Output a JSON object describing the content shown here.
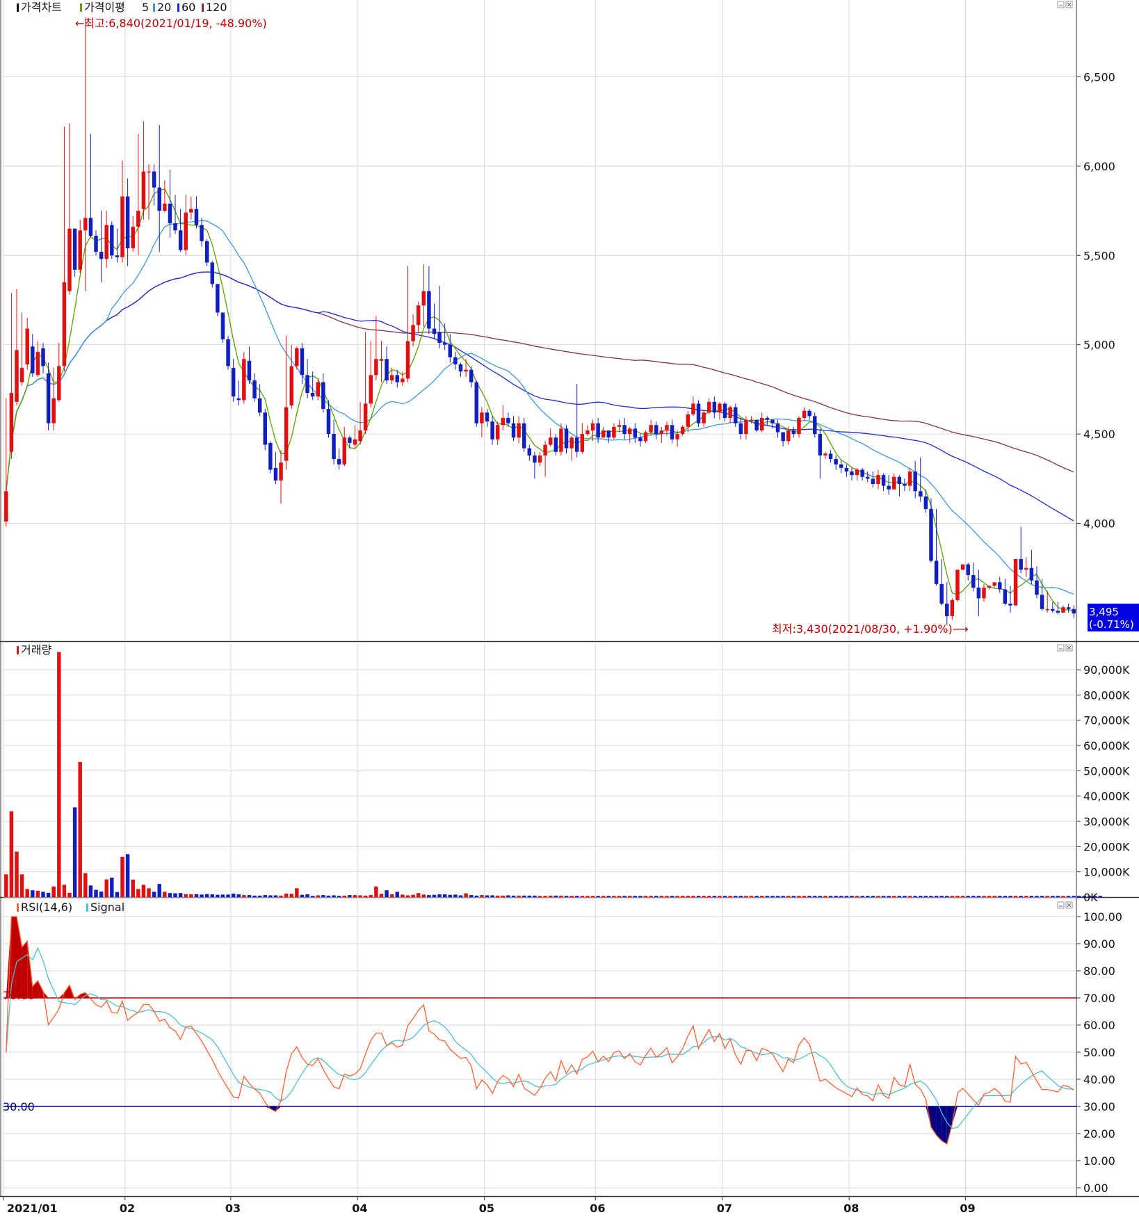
{
  "colors": {
    "up": "#e01010",
    "down": "#1020c0",
    "ma5": "#5aa000",
    "ma20": "#3a9ad9",
    "ma60": "#1c2ad0",
    "ma120": "#80304a",
    "rsi": "#ff6030",
    "signal": "#4ac0d0",
    "ob_line": "#c00000",
    "os_line": "#000080",
    "grid": "#d8d8d8",
    "label_bg": "#0000e0"
  },
  "chart_data": [
    {
      "type": "candlestick",
      "title": "가격차트",
      "legend": [
        {
          "label": "가격이평",
          "color": "#5aa000"
        },
        {
          "label": "5",
          "color": "#5aa000"
        },
        {
          "label": "20",
          "color": "#3a9ad9"
        },
        {
          "label": "60",
          "color": "#1c2ad0"
        },
        {
          "label": "120",
          "color": "#80304a"
        }
      ],
      "ylim": [
        3340,
        6930
      ],
      "yticks": [
        4000,
        4500,
        5000,
        5500,
        6000,
        6500
      ],
      "ytick_labels": [
        "4,000",
        "4,500",
        "5,000",
        "5,500",
        "6,000",
        "6,500"
      ],
      "months": [
        "2021/01",
        "02",
        "03",
        "04",
        "05",
        "06",
        "07",
        "08",
        "09"
      ],
      "month_start_index": [
        0,
        23,
        43,
        67,
        91,
        112,
        136,
        160,
        182
      ],
      "high_note": "←최고:6,840(2021/01/19, -48.90%)",
      "low_note": "최저:3,430(2021/08/30, +1.90%)⟶",
      "last_price": "3,495",
      "last_change": "(-0.71%)",
      "candles": {
        "close": [
          4180,
          4730,
          4970,
          4870,
          5090,
          4840,
          4960,
          4880,
          4560,
          4700,
          4880,
          5350,
          5650,
          5420,
          5640,
          5710,
          5610,
          5520,
          5480,
          5670,
          5500,
          5490,
          5830,
          5540,
          5660,
          5750,
          5970,
          5970,
          5880,
          5750,
          5790,
          5680,
          5640,
          5530,
          5740,
          5760,
          5670,
          5580,
          5460,
          5340,
          5180,
          5030,
          4880,
          4710,
          4690,
          4920,
          4800,
          4700,
          4620,
          4440,
          4300,
          4240,
          4340,
          4650,
          4880,
          4980,
          4830,
          4730,
          4710,
          4790,
          4640,
          4500,
          4360,
          4330,
          4480,
          4450,
          4470,
          4520,
          4670,
          4830,
          4920,
          4920,
          4800,
          4830,
          4790,
          4810,
          5020,
          5110,
          5220,
          5300,
          5090,
          5060,
          5010,
          5000,
          4930,
          4890,
          4850,
          4860,
          4790,
          4560,
          4620,
          4570,
          4470,
          4550,
          4590,
          4560,
          4480,
          4560,
          4420,
          4380,
          4340,
          4380,
          4440,
          4480,
          4400,
          4530,
          4420,
          4480,
          4400,
          4500,
          4520,
          4560,
          4480,
          4520,
          4480,
          4540,
          4550,
          4500,
          4530,
          4480,
          4460,
          4510,
          4550,
          4500,
          4520,
          4550,
          4470,
          4500,
          4540,
          4610,
          4670,
          4560,
          4620,
          4680,
          4620,
          4670,
          4590,
          4650,
          4560,
          4500,
          4580,
          4580,
          4520,
          4590,
          4580,
          4560,
          4510,
          4460,
          4520,
          4500,
          4590,
          4630,
          4600,
          4500,
          4380,
          4390,
          4360,
          4330,
          4310,
          4290,
          4270,
          4300,
          4260,
          4250,
          4220,
          4270,
          4210,
          4190,
          4260,
          4220,
          4210,
          4290,
          4180,
          4150,
          4080,
          3790,
          3660,
          3550,
          3480,
          3570,
          3740,
          3770,
          3710,
          3640,
          3580,
          3640,
          3650,
          3670,
          3630,
          3550,
          3540,
          3800,
          3740,
          3750,
          3680,
          3600,
          3520,
          3520,
          3510,
          3500,
          3530,
          3520,
          3495
        ],
        "open": [
          4010,
          4400,
          4680,
          4790,
          4890,
          4990,
          4830,
          4980,
          4840,
          4560,
          4690,
          4880,
          5300,
          5650,
          5420,
          5640,
          5710,
          5610,
          5520,
          5480,
          5670,
          5500,
          5490,
          5830,
          5540,
          5660,
          5760,
          5970,
          5970,
          5880,
          5750,
          5790,
          5680,
          5640,
          5530,
          5740,
          5760,
          5670,
          5580,
          5460,
          5340,
          5180,
          5030,
          4870,
          4700,
          4690,
          4910,
          4800,
          4700,
          4620,
          4450,
          4310,
          4240,
          4350,
          4660,
          4880,
          4980,
          4830,
          4730,
          4710,
          4790,
          4640,
          4500,
          4360,
          4330,
          4480,
          4440,
          4460,
          4520,
          4670,
          4830,
          4910,
          4920,
          4800,
          4830,
          4790,
          4810,
          5020,
          5110,
          5220,
          5300,
          5090,
          5070,
          5010,
          5000,
          4930,
          4890,
          4850,
          4860,
          4790,
          4560,
          4620,
          4570,
          4470,
          4550,
          4590,
          4560,
          4480,
          4560,
          4420,
          4380,
          4340,
          4380,
          4440,
          4480,
          4400,
          4530,
          4420,
          4480,
          4400,
          4500,
          4520,
          4560,
          4480,
          4520,
          4480,
          4540,
          4550,
          4500,
          4530,
          4480,
          4460,
          4510,
          4550,
          4500,
          4520,
          4550,
          4470,
          4500,
          4540,
          4610,
          4670,
          4560,
          4620,
          4680,
          4620,
          4670,
          4590,
          4650,
          4560,
          4500,
          4580,
          4580,
          4520,
          4590,
          4580,
          4560,
          4510,
          4460,
          4520,
          4500,
          4590,
          4630,
          4600,
          4500,
          4380,
          4390,
          4360,
          4330,
          4310,
          4290,
          4270,
          4300,
          4260,
          4250,
          4220,
          4270,
          4210,
          4190,
          4260,
          4220,
          4210,
          4290,
          4180,
          4150,
          4080,
          3790,
          3660,
          3550,
          3480,
          3570,
          3740,
          3770,
          3710,
          3640,
          3580,
          3640,
          3650,
          3670,
          3630,
          3550,
          3540,
          3800,
          3740,
          3750,
          3680,
          3600,
          3520,
          3520,
          3510,
          3500,
          3530,
          3520
        ],
        "high": [
          4700,
          5290,
          5310,
          5180,
          5150,
          5060,
          5020,
          5010,
          4900,
          4870,
          5010,
          6220,
          6240,
          5650,
          5700,
          6830,
          6180,
          5640,
          5750,
          5750,
          5690,
          5650,
          6030,
          5930,
          5720,
          6180,
          6250,
          6010,
          6010,
          6230,
          5920,
          5980,
          5840,
          5760,
          5840,
          5830,
          5830,
          5710,
          5590,
          5470,
          5310,
          5180,
          5050,
          4920,
          4800,
          4960,
          4990,
          4840,
          4780,
          4640,
          4460,
          4400,
          4410,
          5050,
          5000,
          4990,
          5010,
          4920,
          4850,
          4810,
          4840,
          4690,
          4580,
          4420,
          4540,
          4490,
          4550,
          4680,
          5070,
          5020,
          5160,
          5020,
          4990,
          4870,
          4860,
          4850,
          5440,
          5170,
          5240,
          5450,
          5440,
          5230,
          5330,
          5120,
          5060,
          4960,
          4900,
          4920,
          4880,
          4800,
          4650,
          4640,
          4600,
          4570,
          4660,
          4620,
          4600,
          4600,
          4590,
          4440,
          4400,
          4400,
          4460,
          4530,
          4500,
          4560,
          4550,
          4490,
          4780,
          4560,
          4550,
          4580,
          4590,
          4540,
          4520,
          4560,
          4580,
          4590,
          4540,
          4560,
          4500,
          4520,
          4580,
          4570,
          4540,
          4570,
          4580,
          4520,
          4550,
          4630,
          4710,
          4690,
          4630,
          4700,
          4710,
          4680,
          4680,
          4660,
          4670,
          4590,
          4600,
          4600,
          4570,
          4620,
          4600,
          4580,
          4580,
          4510,
          4540,
          4540,
          4600,
          4650,
          4640,
          4620,
          4530,
          4400,
          4410,
          4380,
          4350,
          4330,
          4310,
          4310,
          4310,
          4290,
          4290,
          4300,
          4280,
          4270,
          4280,
          4270,
          4250,
          4310,
          4350,
          4370,
          4190,
          4140,
          4080,
          3800,
          3670,
          3580,
          3590,
          3770,
          3780,
          3780,
          3740,
          3660,
          3650,
          3660,
          3700,
          3690,
          3650,
          3580,
          3980,
          3810,
          3850,
          3760,
          3690,
          3620,
          3560,
          3560,
          3540,
          3550,
          3540
        ],
        "low": [
          3980,
          4360,
          4660,
          4770,
          4860,
          4820,
          4820,
          4840,
          4520,
          4520,
          4680,
          4850,
          5280,
          5380,
          5400,
          5300,
          5600,
          5500,
          5350,
          5430,
          5480,
          5460,
          5460,
          5440,
          5520,
          5500,
          5700,
          5700,
          5780,
          5520,
          5740,
          5600,
          5620,
          5520,
          5500,
          5700,
          5650,
          5550,
          5440,
          5320,
          5160,
          5010,
          4860,
          4680,
          4660,
          4670,
          4780,
          4680,
          4600,
          4410,
          4280,
          4220,
          4110,
          4300,
          4640,
          4860,
          4780,
          4700,
          4690,
          4690,
          4620,
          4480,
          4330,
          4300,
          4320,
          4420,
          4420,
          4440,
          4500,
          4650,
          4800,
          4790,
          4780,
          4780,
          4760,
          4770,
          4790,
          4990,
          5070,
          5100,
          5060,
          5030,
          4980,
          4970,
          4900,
          4860,
          4820,
          4820,
          4760,
          4540,
          4480,
          4540,
          4440,
          4440,
          4520,
          4540,
          4460,
          4450,
          4400,
          4350,
          4250,
          4320,
          4260,
          4430,
          4380,
          4380,
          4390,
          4350,
          4370,
          4390,
          4490,
          4460,
          4450,
          4480,
          4450,
          4470,
          4510,
          4470,
          4450,
          4450,
          4430,
          4450,
          4490,
          4470,
          4450,
          4490,
          4450,
          4430,
          4490,
          4510,
          4600,
          4540,
          4540,
          4610,
          4590,
          4580,
          4570,
          4560,
          4540,
          4470,
          4470,
          4560,
          4510,
          4510,
          4550,
          4530,
          4480,
          4430,
          4440,
          4480,
          4480,
          4580,
          4580,
          4480,
          4250,
          4360,
          4340,
          4300,
          4280,
          4260,
          4240,
          4240,
          4240,
          4230,
          4200,
          4190,
          4180,
          4160,
          4190,
          4150,
          4180,
          4180,
          4140,
          4120,
          4060,
          3780,
          3650,
          3540,
          3430,
          3460,
          3560,
          3740,
          3680,
          3620,
          3480,
          3560,
          3630,
          3640,
          3610,
          3540,
          3500,
          3560,
          3720,
          3700,
          3660,
          3580,
          3510,
          3500,
          3500,
          3490,
          3500,
          3500,
          3470
        ]
      }
    },
    {
      "type": "bar",
      "title": "거래량",
      "ylim": [
        0,
        98000
      ],
      "yticks": [
        0,
        10000,
        20000,
        30000,
        40000,
        50000,
        60000,
        70000,
        80000,
        90000
      ],
      "ytick_labels": [
        "0K",
        "10,000K",
        "20,000K",
        "30,000K",
        "40,000K",
        "50,000K",
        "60,000K",
        "70,000K",
        "80,000K",
        "90,000K"
      ],
      "values": [
        9000,
        34000,
        18000,
        9000,
        3200,
        2700,
        2500,
        2100,
        1700,
        4200,
        97000,
        4900,
        1700,
        35500,
        53500,
        9500,
        4600,
        2900,
        2200,
        7000,
        7700,
        2000,
        16000,
        17000,
        6900,
        3200,
        4900,
        3500,
        2100,
        5200,
        2100,
        1600,
        1500,
        1600,
        1200,
        1100,
        1200,
        1000,
        1200,
        1100,
        900,
        1000,
        1000,
        1400,
        1100,
        800,
        800,
        600,
        600,
        800,
        700,
        700,
        600,
        1400,
        1300,
        3500,
        900,
        1100,
        500,
        700,
        800,
        600,
        700,
        500,
        600,
        800,
        800,
        700,
        600,
        800,
        4200,
        1300,
        2700,
        1100,
        2100,
        1000,
        700,
        900,
        1600,
        1000,
        800,
        900,
        1100,
        1100,
        900,
        1000,
        700,
        1500,
        800,
        600,
        800,
        700,
        700,
        600,
        600,
        700,
        600,
        600,
        600,
        600,
        600,
        500,
        500,
        600,
        600,
        600,
        500,
        500,
        500,
        500,
        500,
        500,
        500,
        500,
        500,
        500,
        500,
        500,
        500,
        500,
        500,
        500,
        500,
        500,
        500,
        500,
        500,
        500,
        500,
        500,
        500,
        500,
        500,
        500,
        500,
        500,
        500,
        500,
        500,
        500,
        500,
        500,
        500,
        500,
        500,
        500,
        500,
        500,
        500,
        500,
        500,
        500,
        500,
        500,
        500,
        500,
        500,
        500,
        500,
        500,
        500,
        500,
        500,
        500,
        500,
        500,
        500,
        500,
        500,
        500,
        500,
        500,
        500,
        500,
        500,
        500,
        500,
        500,
        500,
        500,
        500,
        500,
        500,
        500,
        500,
        500,
        500,
        500,
        500,
        500,
        500,
        500,
        500,
        500,
        500,
        500,
        500,
        500,
        500,
        500,
        500,
        500,
        500,
        500,
        500,
        500,
        500,
        500
      ]
    },
    {
      "type": "line",
      "title": "RSI(14,6)",
      "legend": [
        {
          "label": "RSI(14,6)",
          "color": "#ff6030"
        },
        {
          "label": "Signal",
          "color": "#4ac0d0"
        }
      ],
      "ylim": [
        0,
        100
      ],
      "yticks": [
        0,
        10,
        20,
        30,
        40,
        50,
        60,
        70,
        80,
        90,
        100
      ],
      "ytick_labels": [
        "0.00",
        "10.00",
        "20.00",
        "30.00",
        "40.00",
        "50.00",
        "60.00",
        "70.00",
        "80.00",
        "90.00",
        "100.00"
      ],
      "levels": [
        {
          "value": 70,
          "label": "70.00"
        },
        {
          "value": 30,
          "label": "30.00"
        }
      ]
    }
  ]
}
